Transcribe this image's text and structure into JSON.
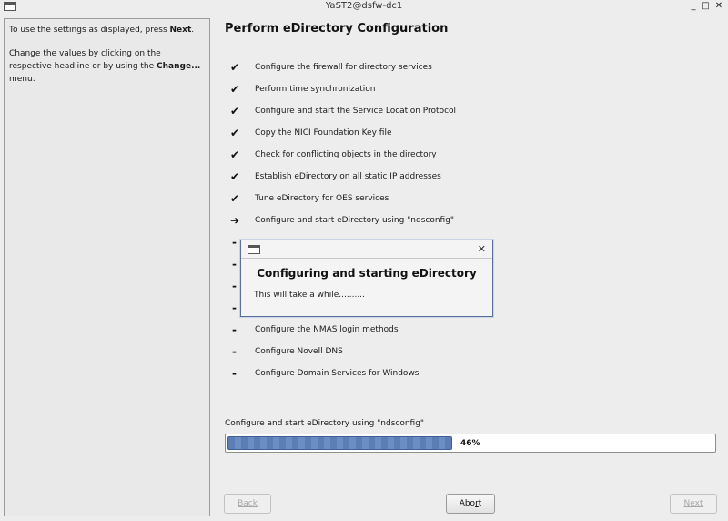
{
  "window": {
    "title": "YaST2@dsfw-dc1",
    "minimize_glyph": "_",
    "maximize_glyph": "□",
    "close_glyph": "✕"
  },
  "help": {
    "line1_pre": "To use the settings as displayed, press ",
    "line1_bold": "Next",
    "line1_post": ".",
    "line2_pre": "Change the values by clicking on the respective headline or by using the ",
    "line2_bold": "Change...",
    "line2_post": " menu."
  },
  "main": {
    "heading": "Perform eDirectory Configuration",
    "steps": [
      {
        "mark": "✔",
        "label": "Configure the firewall for directory services"
      },
      {
        "mark": "✔",
        "label": "Perform time synchronization"
      },
      {
        "mark": "✔",
        "label": "Configure and start the Service Location Protocol"
      },
      {
        "mark": "✔",
        "label": "Copy the NICI Foundation Key file"
      },
      {
        "mark": "✔",
        "label": "Check for conflicting objects in the directory"
      },
      {
        "mark": "✔",
        "label": "Establish eDirectory on all static IP addresses"
      },
      {
        "mark": "✔",
        "label": "Tune eDirectory for OES services"
      },
      {
        "mark": "➔",
        "label": "Configure and start eDirectory using \"ndsconfig\""
      },
      {
        "mark": "-",
        "label": ""
      },
      {
        "mark": "-",
        "label": ""
      },
      {
        "mark": "-",
        "label": ""
      },
      {
        "mark": "-",
        "label": ""
      },
      {
        "mark": "-",
        "label": "Configure the NMAS login methods"
      },
      {
        "mark": "-",
        "label": "Configure Novell DNS"
      },
      {
        "mark": "-",
        "label": "Configure Domain Services for Windows"
      }
    ]
  },
  "dialog": {
    "close_glyph": "✕",
    "heading": "Configuring and starting eDirectory",
    "message": "This will take a while.........."
  },
  "progress": {
    "label": "Configure and start eDirectory using \"ndsconfig\"",
    "percent_text": "46%",
    "value": 0.46
  },
  "buttons": {
    "back": "Back",
    "abort_pre": "Abo",
    "abort_u": "r",
    "abort_post": "t",
    "next": "Next"
  }
}
